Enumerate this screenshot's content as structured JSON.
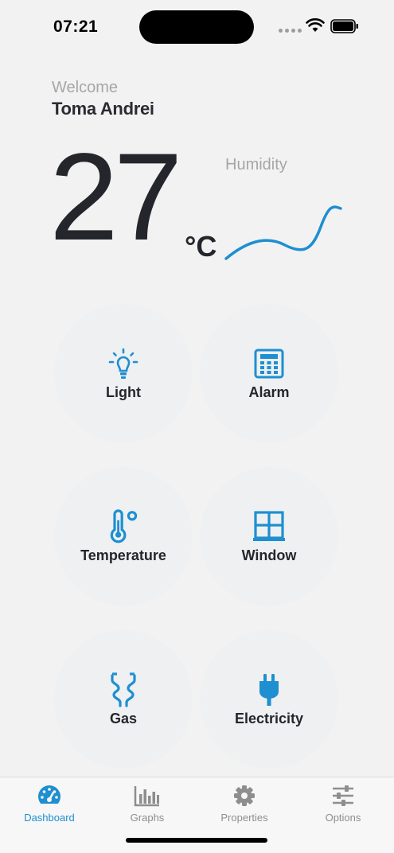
{
  "status_bar": {
    "time": "07:21"
  },
  "header": {
    "welcome": "Welcome",
    "user_name": "Toma Andrei"
  },
  "climate": {
    "temperature": "27",
    "unit": "°C",
    "humidity_label": "Humidity"
  },
  "tiles": [
    {
      "label": "Light",
      "icon": "lightbulb-icon"
    },
    {
      "label": "Alarm",
      "icon": "keypad-icon"
    },
    {
      "label": "Temperature",
      "icon": "thermometer-icon"
    },
    {
      "label": "Window",
      "icon": "window-icon"
    },
    {
      "label": "Gas",
      "icon": "gas-pipe-icon"
    },
    {
      "label": "Electricity",
      "icon": "plug-icon"
    }
  ],
  "tab_bar": {
    "tabs": [
      {
        "label": "Dashboard",
        "icon": "speedometer-icon",
        "active": true
      },
      {
        "label": "Graphs",
        "icon": "bar-chart-icon",
        "active": false
      },
      {
        "label": "Properties",
        "icon": "gear-icon",
        "active": false
      },
      {
        "label": "Options",
        "icon": "sliders-icon",
        "active": false
      }
    ]
  },
  "colors": {
    "accent": "#1e8fd0",
    "background": "#f2f2f2",
    "tile": "#eef0f2",
    "text": "#24262b",
    "muted": "#a6a6a6"
  }
}
